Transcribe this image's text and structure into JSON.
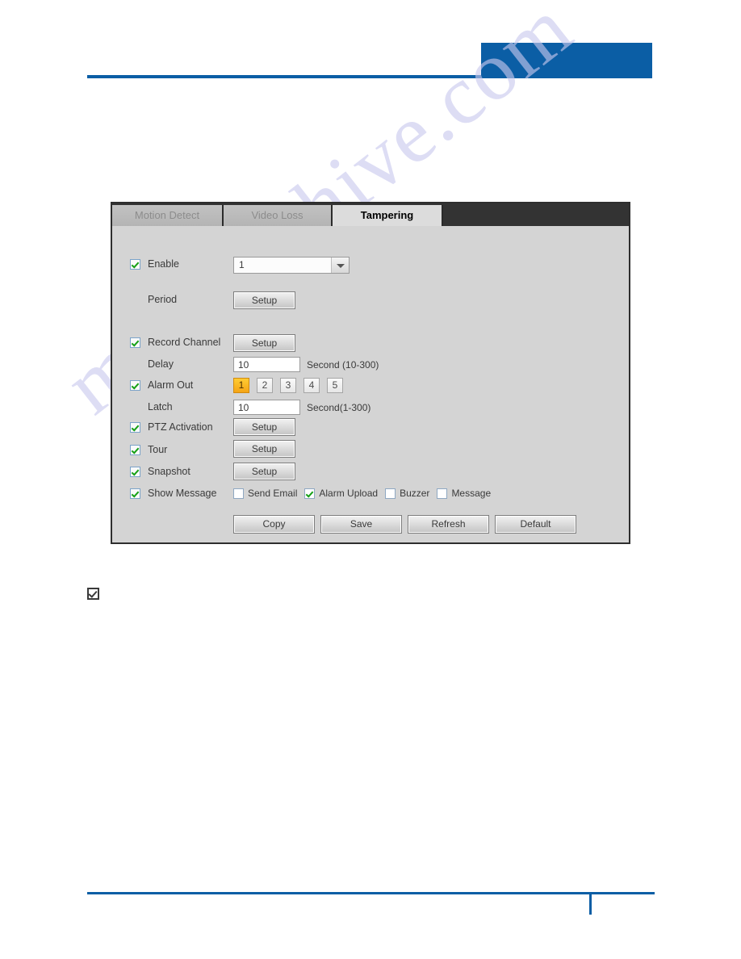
{
  "page": {
    "watermark_text": "manualshive.com",
    "accent_color": "#0b5ea5"
  },
  "panel": {
    "tabs": [
      {
        "label": "Motion Detect",
        "active": false
      },
      {
        "label": "Video Loss",
        "active": false
      },
      {
        "label": "Tampering",
        "active": true
      }
    ],
    "rows": {
      "enable": {
        "label": "Enable",
        "checked": true,
        "channel_value": "1"
      },
      "period": {
        "label": "Period",
        "button": "Setup"
      },
      "record_channel": {
        "label": "Record Channel",
        "checked": true,
        "button": "Setup"
      },
      "delay": {
        "label": "Delay",
        "value": "10",
        "unit": "Second (10-300)"
      },
      "alarm_out": {
        "label": "Alarm Out",
        "checked": true,
        "channels": [
          "1",
          "2",
          "3",
          "4",
          "5"
        ],
        "selected": "1"
      },
      "latch": {
        "label": "Latch",
        "value": "10",
        "unit": "Second(1-300)"
      },
      "ptz_activation": {
        "label": "PTZ Activation",
        "checked": true,
        "button": "Setup"
      },
      "tour": {
        "label": "Tour",
        "checked": true,
        "button": "Setup"
      },
      "snapshot": {
        "label": "Snapshot",
        "checked": true,
        "button": "Setup"
      },
      "show_message": {
        "label": "Show Message",
        "checked": true,
        "options": [
          {
            "label": "Send Email",
            "checked": false
          },
          {
            "label": "Alarm Upload",
            "checked": true
          },
          {
            "label": "Buzzer",
            "checked": false
          },
          {
            "label": "Message",
            "checked": false
          }
        ]
      }
    },
    "actions": [
      {
        "label": "Copy"
      },
      {
        "label": "Save"
      },
      {
        "label": "Refresh"
      },
      {
        "label": "Default"
      }
    ]
  }
}
